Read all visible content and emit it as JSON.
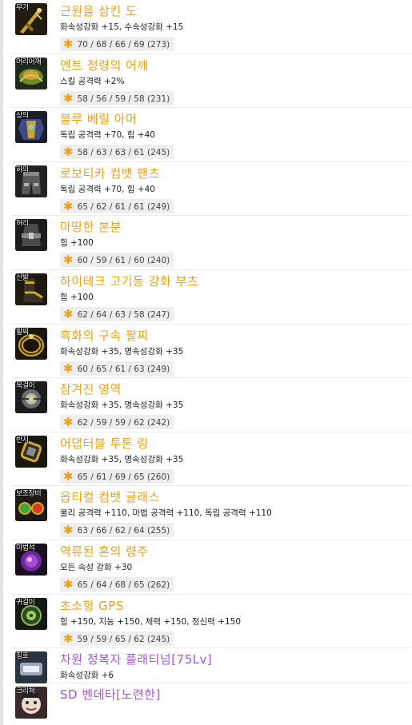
{
  "items": [
    {
      "slot": "무기",
      "name": "근원을 삼킨 도",
      "stats": "화속성강화 +15, 수속성강화 +15",
      "grade": "70 / 68 / 66 / 69 (273)",
      "icon": "sword-icon"
    },
    {
      "slot": "머리어깨",
      "name": "엔트 정령의 어깨",
      "stats": "스킬 공격력 +2%",
      "grade": "58 / 56 / 59 / 58 (231)",
      "icon": "shoulder-armor-icon"
    },
    {
      "slot": "상의",
      "name": "블루 베릴 아머",
      "stats": "독립 공격력 +70, 힘 +40",
      "grade": "58 / 63 / 63 / 61 (245)",
      "icon": "top-armor-icon"
    },
    {
      "slot": "하의",
      "name": "로보티카 컴뱃 팬츠",
      "stats": "독립 공격력 +70, 힘 +40",
      "grade": "65 / 62 / 61 / 61 (249)",
      "icon": "pants-icon"
    },
    {
      "slot": "허리",
      "name": "마땅한 본분",
      "stats": "힘 +100",
      "grade": "60 / 59 / 61 / 60 (240)",
      "icon": "belt-icon"
    },
    {
      "slot": "신발",
      "name": "하이테크 고기동 강화 부츠",
      "stats": "힘 +100",
      "grade": "62 / 64 / 63 / 58 (247)",
      "icon": "boots-icon"
    },
    {
      "slot": "팔찌",
      "name": "흑화의 구속 팔찌",
      "stats": "화속성강화 +35, 명속성강화 +35",
      "grade": "60 / 65 / 61 / 63 (249)",
      "icon": "bracelet-icon"
    },
    {
      "slot": "목걸이",
      "name": "잠겨진 영역",
      "stats": "화속성강화 +35, 명속성강화 +35",
      "grade": "62 / 59 / 59 / 62 (242)",
      "icon": "necklace-icon"
    },
    {
      "slot": "반지",
      "name": "어댑터블 투톤 링",
      "stats": "화속성강화 +35, 명속성강화 +35",
      "grade": "65 / 61 / 69 / 65 (260)",
      "icon": "ring-icon"
    },
    {
      "slot": "보조장비",
      "name": "옵티컬 컴뱃 글래스",
      "stats": "물리 공격력 +110, 마법 공격력 +110, 독립 공격력 +110",
      "grade": "63 / 66 / 62 / 64 (255)",
      "icon": "glasses-icon"
    },
    {
      "slot": "마법석",
      "name": "역류된 혼의 령주",
      "stats": "모든 속성 강화 +30",
      "grade": "65 / 64 / 68 / 65 (262)",
      "icon": "magic-stone-icon"
    },
    {
      "slot": "귀걸이",
      "name": "초소형 GPS",
      "stats": "힘 +150, 지능 +150, 체력 +150, 정신력 +150",
      "grade": "59 / 59 / 65 / 62 (245)",
      "icon": "earring-icon"
    },
    {
      "slot": "칭호",
      "name": "차원 정복자 플래티넘[75Lv]",
      "stats": "화속성강화 +6",
      "grade": "",
      "icon": "title-icon"
    },
    {
      "slot": "크리쳐",
      "name": "SD 벤데타[노련한]",
      "stats": "",
      "grade": "",
      "icon": "creature-icon"
    }
  ],
  "colors": {
    "epic_name": "#e9a21c",
    "rare_name": "#a158d6",
    "grade_bg": "#eeeeee"
  },
  "grade_icon": "star-icon"
}
